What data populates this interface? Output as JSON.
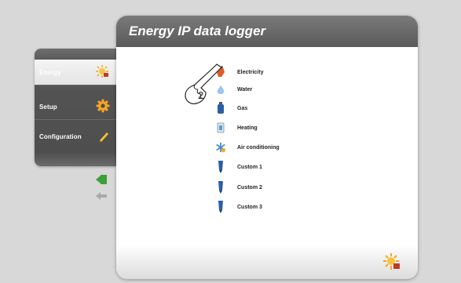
{
  "header": {
    "title": "Energy IP data logger"
  },
  "menu": {
    "items": [
      {
        "label": "Energy",
        "icon": "energy-sun-icon",
        "selected": true
      },
      {
        "label": "Setup",
        "icon": "gear-icon",
        "selected": false
      },
      {
        "label": "Configuration",
        "icon": "pencil-icon",
        "selected": false
      }
    ]
  },
  "nav": {
    "forward_icon": "green-arrow-icon",
    "back_icon": "back-arrow-icon"
  },
  "list": {
    "items": [
      {
        "label": "Electricity",
        "icon": "electricity-plug-icon"
      },
      {
        "label": "Water",
        "icon": "water-drop-icon"
      },
      {
        "label": "Gas",
        "icon": "gas-cylinder-icon"
      },
      {
        "label": "Heating",
        "icon": "heating-radiator-icon"
      },
      {
        "label": "Air conditioning",
        "icon": "snowflake-icon"
      },
      {
        "label": "Custom 1",
        "icon": "custom-meter-icon"
      },
      {
        "label": "Custom 2",
        "icon": "custom-meter-icon"
      },
      {
        "label": "Custom 3",
        "icon": "custom-meter-icon"
      }
    ]
  },
  "callout": {
    "number": "2",
    "icon": "pointing-hand-icon"
  },
  "footer": {
    "icon": "energy-sun-icon"
  },
  "colors": {
    "accent_orange": "#f5a623",
    "header_gray": "#666666",
    "meter_blue": "#2a5ea8",
    "nav_green": "#3aa03a"
  }
}
